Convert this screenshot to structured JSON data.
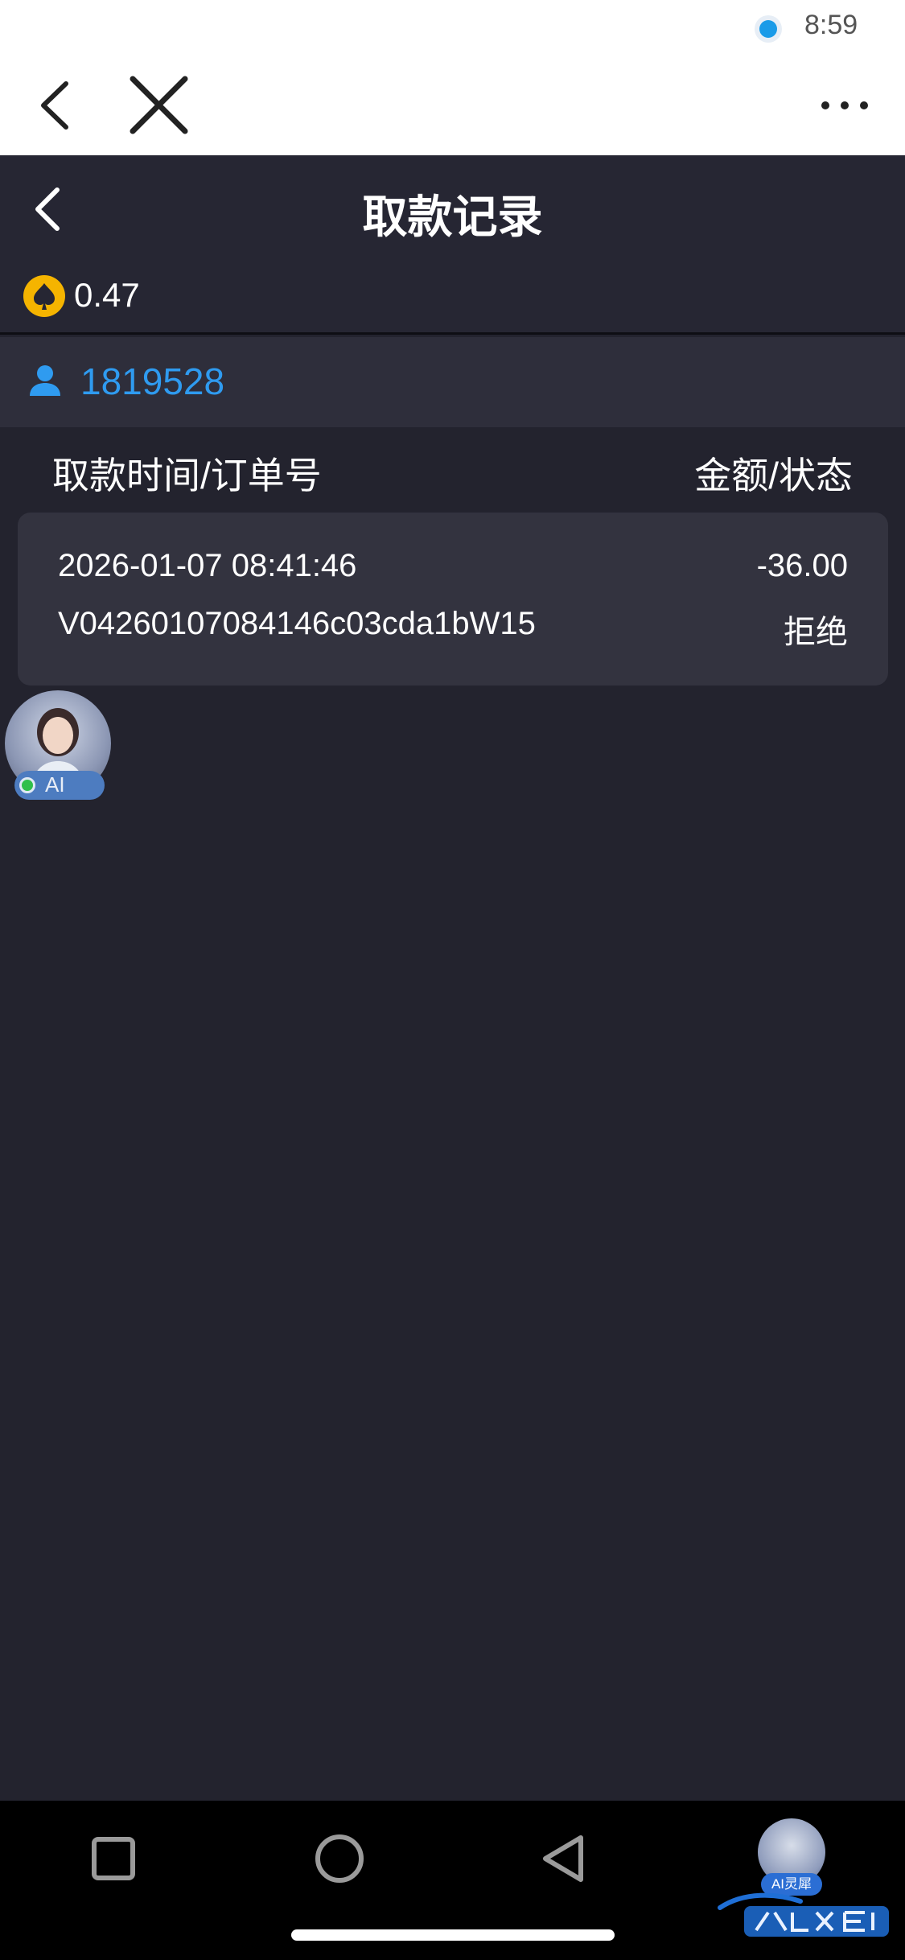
{
  "status_bar": {
    "time": "8:59"
  },
  "header": {
    "title": "取款记录"
  },
  "balance": {
    "value": "0.47"
  },
  "user": {
    "id": "1819528"
  },
  "columns": {
    "left": "取款时间/订单号",
    "right": "金额/状态"
  },
  "records": [
    {
      "time": "2026-01-07 08:41:46",
      "order_no": "V04260107084146c03cda1bW15",
      "amount": "-36.00",
      "status": "拒绝"
    }
  ],
  "ai_widget": {
    "label": "AI"
  },
  "nav_bar": {
    "ai_label": "AI灵犀"
  },
  "colors": {
    "background": "#23232e",
    "accent_blue": "#2f9bf0",
    "coin": "#f5b400"
  }
}
